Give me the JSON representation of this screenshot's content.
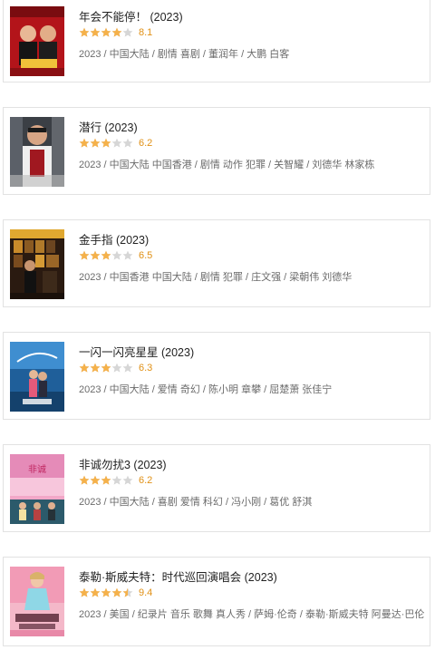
{
  "colors": {
    "star_full": "#f5b14a",
    "star_empty": "#d6d6d6",
    "score": "#e09015"
  },
  "movies": [
    {
      "title": "年会不能停！ (2023)",
      "stars": 4,
      "score": "8.1",
      "meta": "2023 / 中国大陆 / 剧情 喜剧 / 董润年 / 大鹏 白客"
    },
    {
      "title": "潜行 (2023)",
      "stars": 3,
      "score": "6.2",
      "meta": "2023 / 中国大陆 中国香港 / 剧情 动作 犯罪 / 关智耀 / 刘德华 林家栋"
    },
    {
      "title": "金手指 (2023)",
      "stars": 3,
      "score": "6.5",
      "meta": "2023 / 中国香港 中国大陆 / 剧情 犯罪 / 庄文强 / 梁朝伟 刘德华"
    },
    {
      "title": "一闪一闪亮星星 (2023)",
      "stars": 3,
      "score": "6.3",
      "meta": "2023 / 中国大陆 / 爱情 奇幻 / 陈小明 章攀 / 屈楚萧 张佳宁"
    },
    {
      "title": "非诚勿扰3 (2023)",
      "stars": 3,
      "score": "6.2",
      "meta": "2023 / 中国大陆 / 喜剧 爱情 科幻 / 冯小刚 / 葛优 舒淇"
    },
    {
      "title": "泰勒·斯威夫特：时代巡回演唱会 (2023)",
      "stars": 4.5,
      "score": "9.4",
      "meta": "2023 / 美国 / 纪录片 音乐 歌舞 真人秀 / 萨姆·伦奇 / 泰勒·斯威夫特 阿曼达·巴伦"
    }
  ]
}
